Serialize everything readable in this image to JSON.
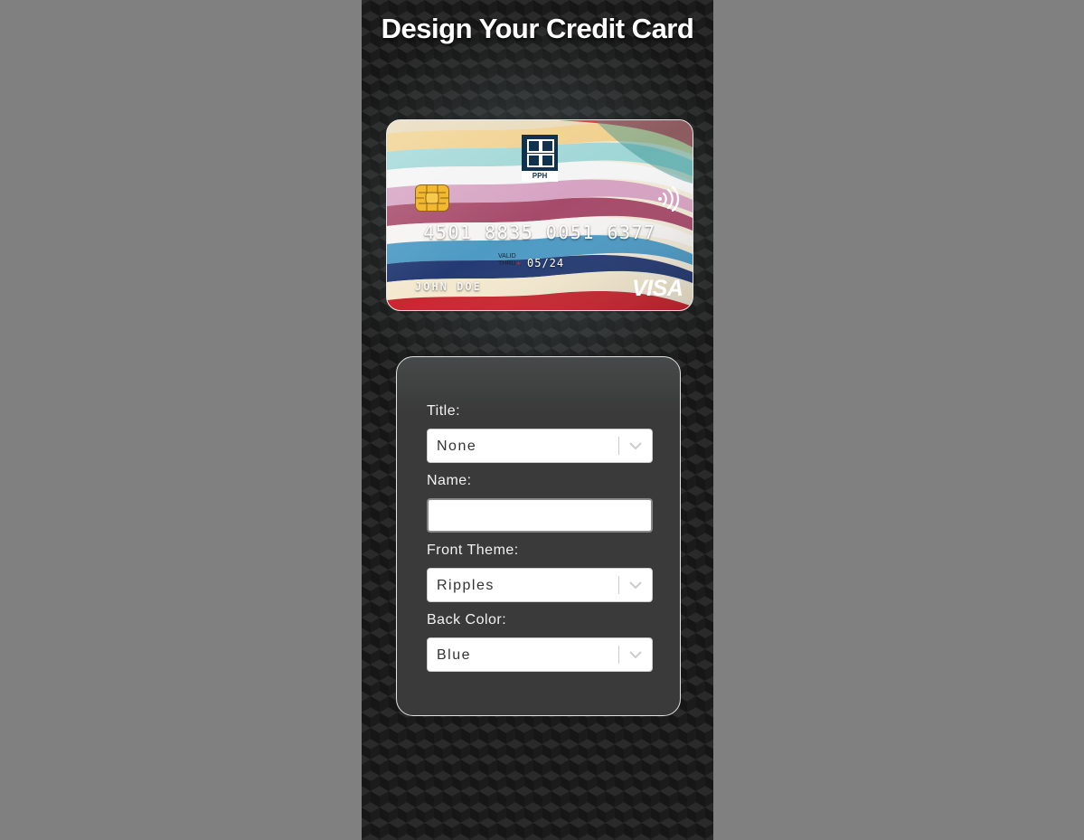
{
  "header": {
    "title": "Design Your Credit Card"
  },
  "card": {
    "logo_text": "PPH",
    "number": "4501 8835 0051 6377",
    "valid_line1": "VALID",
    "valid_line2": "THRU",
    "expiry": "05/24",
    "holder": "JOHN DOE",
    "brand": "VISA",
    "icons": [
      "chip-icon",
      "contactless-icon",
      "pph-logo"
    ]
  },
  "form": {
    "title_label": "Title:",
    "title_value": "None",
    "name_label": "Name:",
    "name_value": "",
    "front_theme_label": "Front Theme:",
    "front_theme_value": "Ripples",
    "back_color_label": "Back Color:",
    "back_color_value": "Blue"
  },
  "colors": {
    "page_bg": "#808080",
    "panel_bg": "#3a3a3a",
    "logo_blue": "#10324e"
  }
}
